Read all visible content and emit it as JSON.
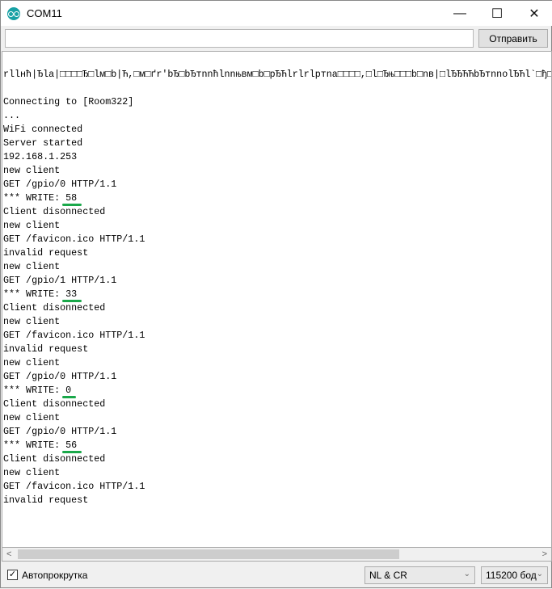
{
  "window": {
    "title": "COM11",
    "icon": "arduino-logo-icon"
  },
  "send": {
    "input_value": "",
    "button_label": "Отправить"
  },
  "output": {
    "lines": [
      "rllнћ|Ђla|□□□□Ђ□lм□b|Ћ,□м□ґr'bЂ□bЂтnnћlnnњвм□b□pЂЋlrlrlpтna□□□□,□l□Ђњ□□□b□nв|□lЂЂЋЋbЂтnnolЂЋl`□ђ□□n",
      "",
      "Connecting to [Room322]",
      "...",
      "WiFi connected",
      "Server started",
      "192.168.1.253",
      "new client",
      "GET /gpio/0 HTTP/1.1",
      {
        "prefix": "*** WRITE: ",
        "value": "58"
      },
      "Client disonnected",
      "new client",
      "GET /favicon.ico HTTP/1.1",
      "invalid request",
      "new client",
      "GET /gpio/1 HTTP/1.1",
      {
        "prefix": "*** WRITE: ",
        "value": "33"
      },
      "Client disonnected",
      "new client",
      "GET /favicon.ico HTTP/1.1",
      "invalid request",
      "new client",
      "GET /gpio/0 HTTP/1.1",
      {
        "prefix": "*** WRITE: ",
        "value": "0"
      },
      "Client disonnected",
      "new client",
      "GET /gpio/0 HTTP/1.1",
      {
        "prefix": "*** WRITE: ",
        "value": "56"
      },
      "Client disonnected",
      "new client",
      "GET /favicon.ico HTTP/1.1",
      "invalid request"
    ],
    "highlight_color": "#1aa84a"
  },
  "footer": {
    "autoscroll_label": "Автопрокрутка",
    "autoscroll_checked": true,
    "line_ending": "NL & CR",
    "baud": "115200 бод"
  }
}
